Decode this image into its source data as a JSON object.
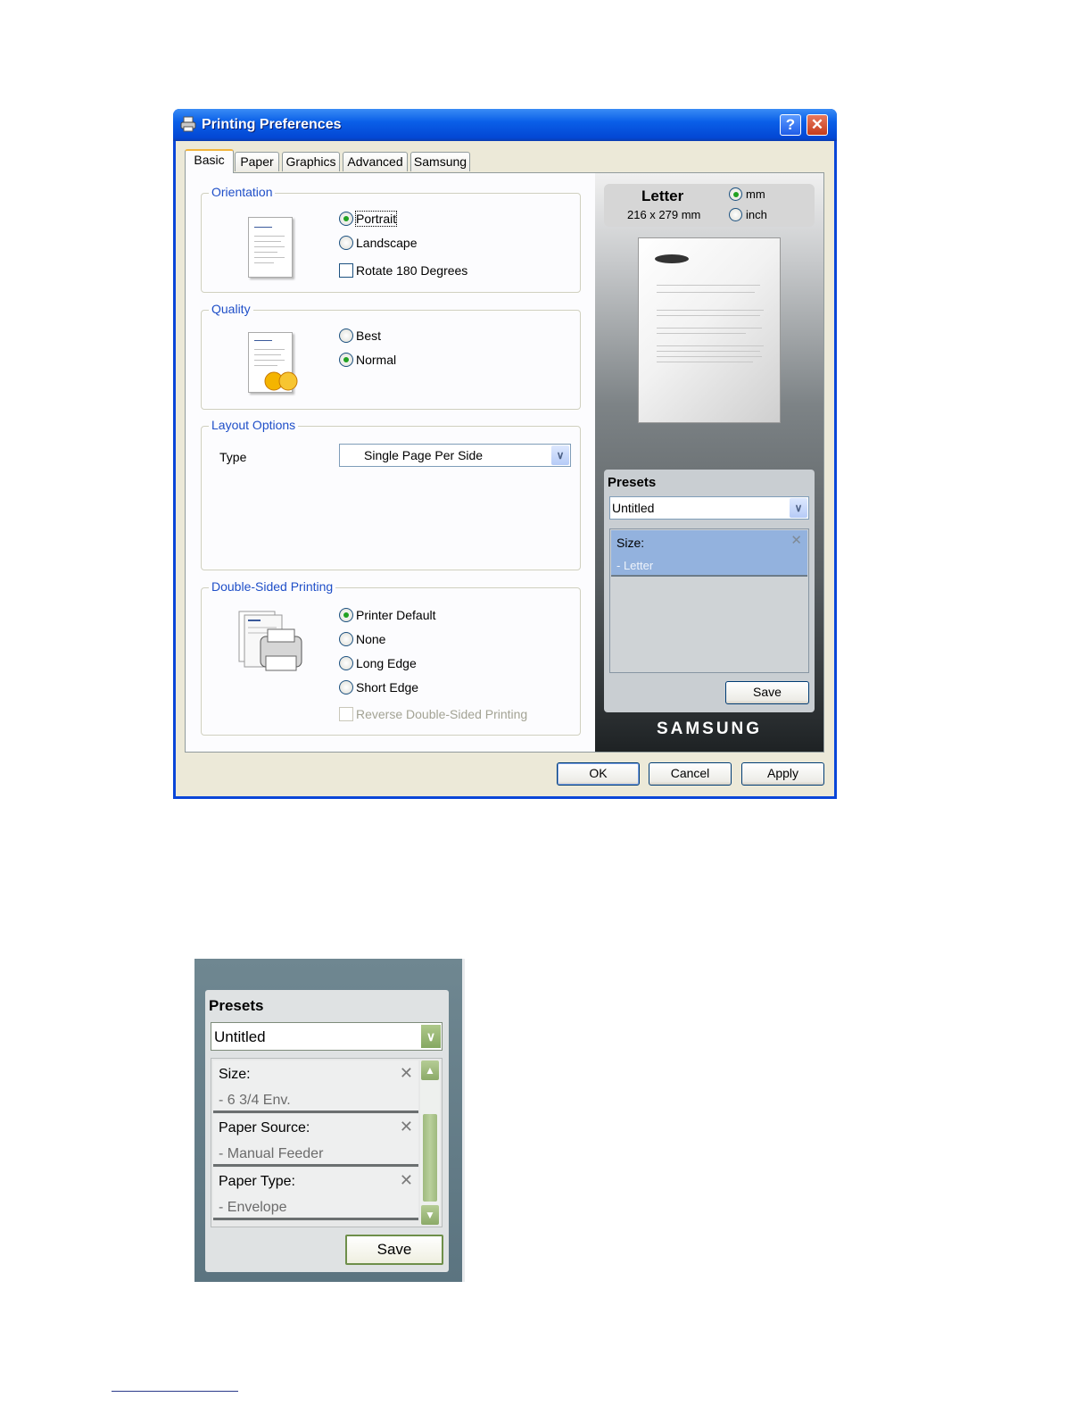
{
  "window": {
    "title": "Printing Preferences",
    "help_glyph": "?",
    "close_glyph": "✕"
  },
  "tabs": [
    {
      "label": "Basic",
      "active": true
    },
    {
      "label": "Paper",
      "active": false
    },
    {
      "label": "Graphics",
      "active": false
    },
    {
      "label": "Advanced",
      "active": false
    },
    {
      "label": "Samsung",
      "active": false
    }
  ],
  "orientation": {
    "legend": "Orientation",
    "options": [
      {
        "label": "Portrait",
        "selected": true
      },
      {
        "label": "Landscape",
        "selected": false
      }
    ],
    "rotate_label": "Rotate 180 Degrees",
    "rotate_checked": false
  },
  "quality": {
    "legend": "Quality",
    "options": [
      {
        "label": "Best",
        "selected": false
      },
      {
        "label": "Normal",
        "selected": true
      }
    ]
  },
  "layout": {
    "legend": "Layout Options",
    "type_label": "Type",
    "type_value": "Single Page Per Side"
  },
  "duplex": {
    "legend": "Double-Sided Printing",
    "options": [
      {
        "label": "Printer Default",
        "selected": true
      },
      {
        "label": "None",
        "selected": false
      },
      {
        "label": "Long Edge",
        "selected": false
      },
      {
        "label": "Short Edge",
        "selected": false
      }
    ],
    "reverse_label": "Reverse Double-Sided Printing",
    "reverse_enabled": false
  },
  "paper_info": {
    "name": "Letter",
    "dimensions": "216 x 279 mm",
    "units": [
      {
        "label": "mm",
        "selected": true
      },
      {
        "label": "inch",
        "selected": false
      }
    ]
  },
  "presets": {
    "title": "Presets",
    "selected": "Untitled",
    "items": [
      {
        "heading": "Size:",
        "value": "- Letter",
        "remove_glyph": "✕"
      }
    ],
    "save_label": "Save"
  },
  "brand": "SAMSUNG",
  "footer_buttons": {
    "ok": "OK",
    "cancel": "Cancel",
    "apply": "Apply"
  },
  "zoomed_presets": {
    "title": "Presets",
    "selected": "Untitled",
    "items": [
      {
        "heading": "Size:",
        "value": "- 6 3/4 Env.",
        "remove_glyph": "✕"
      },
      {
        "heading": "Paper Source:",
        "value": "- Manual Feeder",
        "remove_glyph": "✕"
      },
      {
        "heading": "Paper Type:",
        "value": "- Envelope",
        "remove_glyph": "✕"
      }
    ],
    "scroll_up_glyph": "▲",
    "scroll_down_glyph": "▼",
    "save_label": "Save"
  },
  "colors": {
    "titlebar": "#0a5fe8",
    "legend_text": "#1f4fc8",
    "preset_selected": "#93b2de",
    "zoom_accent": "#8caa68"
  }
}
